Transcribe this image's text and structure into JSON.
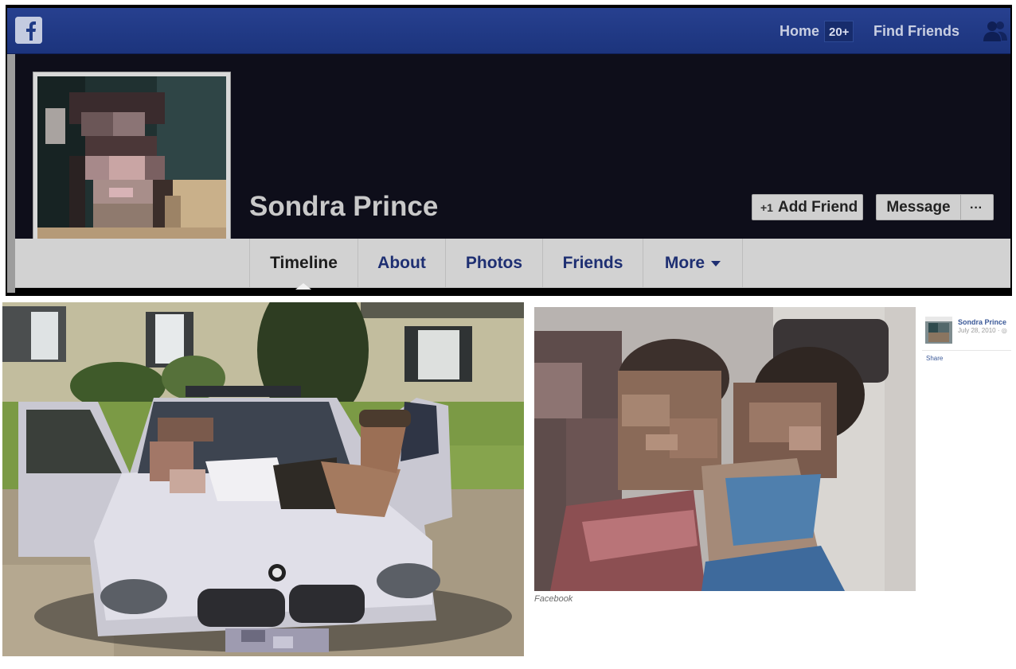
{
  "header": {
    "nav": {
      "home_label": "Home",
      "home_badge": "20+",
      "find_friends_label": "Find Friends"
    },
    "icons": [
      "facebook-logo-icon",
      "friend-requests-icon"
    ]
  },
  "profile": {
    "name": "Sondra Prince",
    "actions": {
      "add_friend_label": "Add Friend",
      "message_label": "Message",
      "more_label": "···"
    },
    "tabs": [
      {
        "label": "Timeline",
        "active": true
      },
      {
        "label": "About",
        "active": false
      },
      {
        "label": "Photos",
        "active": false
      },
      {
        "label": "Friends",
        "active": false
      },
      {
        "label": "More",
        "active": false
      }
    ]
  },
  "photos": {
    "caption": "Facebook"
  },
  "side_post": {
    "author": "Sondra Prince",
    "date": "July 28, 2010 · ◎",
    "share_label": "Share"
  },
  "colors": {
    "facebook_blue": "#1e3a8a",
    "tab_text": "#1e2f72",
    "link": "#3b5998"
  }
}
